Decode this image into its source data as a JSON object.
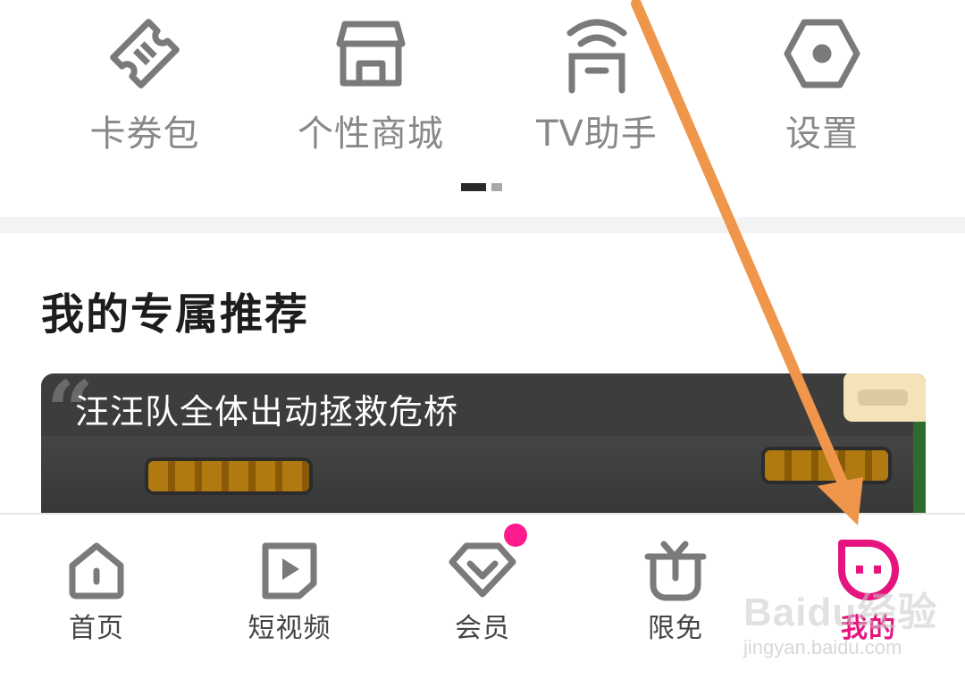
{
  "quick_grid": {
    "items": [
      {
        "label": "卡券包",
        "icon": "ticket-icon"
      },
      {
        "label": "个性商城",
        "icon": "store-icon"
      },
      {
        "label": "TV助手",
        "icon": "tv-remote-icon"
      },
      {
        "label": "设置",
        "icon": "gear-icon"
      }
    ],
    "page_indicator": {
      "current": 1,
      "total": 2
    }
  },
  "recommend": {
    "section_title": "我的专属推荐",
    "card_title": "汪汪队全体出动拯救危桥"
  },
  "tabbar": {
    "tabs": [
      {
        "label": "首页",
        "icon": "home-icon"
      },
      {
        "label": "短视频",
        "icon": "play-icon"
      },
      {
        "label": "会员",
        "icon": "vip-diamond-icon",
        "badge_dot": true
      },
      {
        "label": "限免",
        "icon": "gift-icon"
      },
      {
        "label": "我的",
        "icon": "profile-face-icon",
        "active": true
      }
    ],
    "active_color": "#e5147f"
  },
  "annotation": {
    "arrow_color": "#f0964a"
  },
  "watermark": {
    "text": "Baidu经验",
    "sub": "jingyan.baidu.com"
  },
  "colors": {
    "icon_gray": "#7a7a7a",
    "badge_dot": "#ff1b8d"
  }
}
